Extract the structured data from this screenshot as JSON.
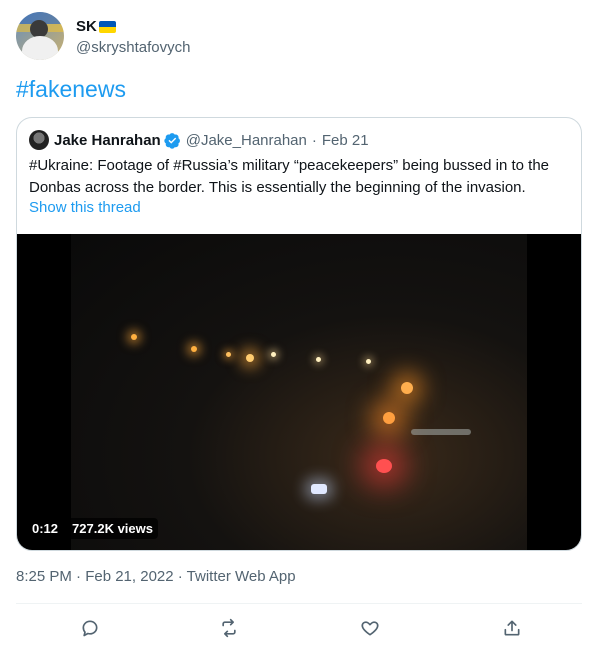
{
  "tweet": {
    "author": {
      "display_name": "SK",
      "handle": "@skryshtafovych"
    },
    "text": "#fakenews",
    "meta": "8:25 PM · Feb 21, 2022 · Twitter Web App"
  },
  "quoted_tweet": {
    "author_name": "Jake Hanrahan",
    "handle": "@Jake_Hanrahan",
    "separator": "·",
    "date": "Feb 21",
    "text": "#Ukraine: Footage of #Russia’s military “peacekeepers” being bussed in to the Donbas across the border. This is essentially the beginning of the invasion.",
    "show_thread": "Show this thread",
    "video": {
      "duration": "0:12",
      "views": "727.2K views"
    }
  },
  "actions": [
    {
      "name": "reply",
      "icon": "reply-icon"
    },
    {
      "name": "retweet",
      "icon": "retweet-icon"
    },
    {
      "name": "like",
      "icon": "heart-icon"
    },
    {
      "name": "share",
      "icon": "share-icon"
    }
  ],
  "colors": {
    "accent": "#1d9bf0",
    "secondary_text": "#536471",
    "border": "#cfd9de"
  }
}
